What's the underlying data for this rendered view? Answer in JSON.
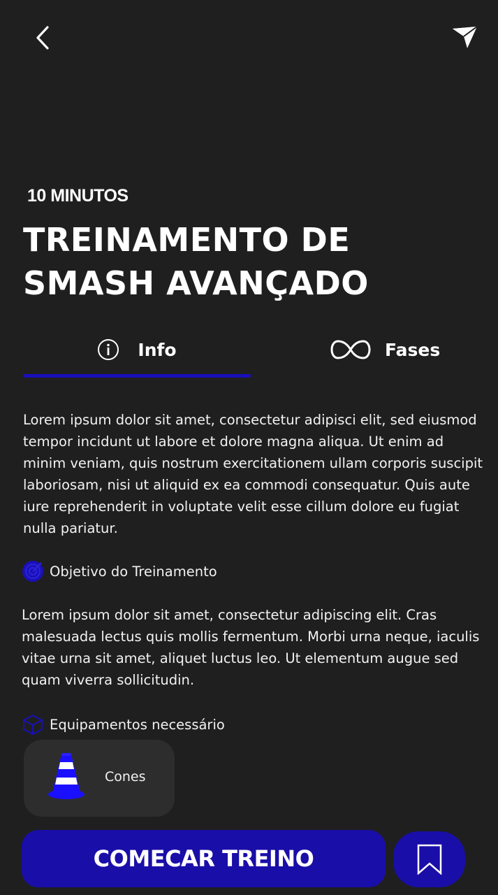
{
  "header": {
    "back_icon": "chevron-left-icon",
    "share_icon": "send-icon"
  },
  "workout": {
    "duration": "10 MINUTOS",
    "title": "TREINAMENTO DE SMASH AVANÇADO"
  },
  "tabs": [
    {
      "label": "Info",
      "icon": "info-icon",
      "active": true
    },
    {
      "label": "Fases",
      "icon": "infinity-icon",
      "active": false
    }
  ],
  "info": {
    "description": "Lorem ipsum dolor sit amet, consectetur adipisci elit, sed eiusmod tempor incidunt ut labore et dolore magna aliqua. Ut enim ad minim veniam, quis nostrum exercitationem ullam corporis suscipit laboriosam, nisi ut aliquid ex ea commodi consequatur. Quis aute iure reprehenderit in voluptate velit esse cillum dolore eu fugiat nulla pariatur.",
    "objective_heading": "Objetivo do Treinamento",
    "objective_text": "Lorem ipsum dolor sit amet, consectetur adipiscing elit. Cras malesuada lectus quis mollis fermentum. Morbi urna neque, iaculis vitae urna sit amet, aliquet luctus leo. Ut elementum augue sed quam viverra sollicitudin.",
    "equipment_heading": "Equipamentos necessário",
    "equipment": [
      {
        "label": "Cones",
        "icon": "traffic-cone-icon"
      }
    ]
  },
  "actions": {
    "start_label": "COMECAR TREINO",
    "save_icon": "bookmark-icon"
  },
  "colors": {
    "background": "#1f1f20",
    "accent": "#1a0ea8",
    "card": "#2d2d2e"
  }
}
